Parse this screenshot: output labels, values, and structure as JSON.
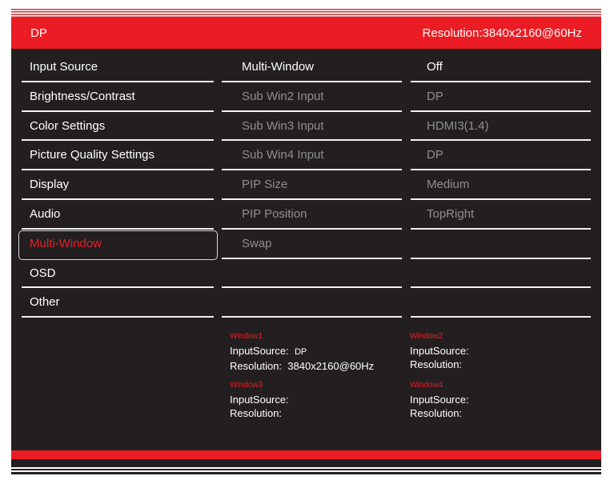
{
  "header": {
    "source": "DP",
    "resolution": "Resolution:3840x2160@60Hz"
  },
  "menu": {
    "items": [
      {
        "label": "Input Source"
      },
      {
        "label": "Brightness/Contrast"
      },
      {
        "label": "Color Settings"
      },
      {
        "label": "Picture Quality Settings"
      },
      {
        "label": "Display"
      },
      {
        "label": "Audio"
      },
      {
        "label": "Multi-Window"
      },
      {
        "label": "OSD"
      },
      {
        "label": "Other"
      }
    ],
    "selected": "Multi-Window"
  },
  "settings": [
    {
      "label": "Multi-Window",
      "value": "Off",
      "enabled": true
    },
    {
      "label": "Sub Win2 Input",
      "value": "DP",
      "enabled": false
    },
    {
      "label": "Sub Win3 Input",
      "value": "HDMI3(1.4)",
      "enabled": false
    },
    {
      "label": "Sub Win4 Input",
      "value": "DP",
      "enabled": false
    },
    {
      "label": "PIP Size",
      "value": "Medium",
      "enabled": false
    },
    {
      "label": "PIP Position",
      "value": "TopRight",
      "enabled": false
    },
    {
      "label": "Swap",
      "value": "",
      "enabled": false
    }
  ],
  "windows": [
    {
      "title": "Window1",
      "input_label": "InputSource:",
      "input": "DP",
      "res_label": "Resolution:",
      "res": "3840x2160@60Hz"
    },
    {
      "title": "Window2",
      "input_label": "InputSource:",
      "input": "",
      "res_label": "Resolution:",
      "res": ""
    },
    {
      "title": "Window3",
      "input_label": "InputSource:",
      "input": "",
      "res_label": "Resolution:",
      "res": ""
    },
    {
      "title": "Window4",
      "input_label": "InputSource:",
      "input": "",
      "res_label": "Resolution:",
      "res": ""
    }
  ],
  "colors": {
    "accent": "#ec1c24",
    "background": "#231f20",
    "disabled": "#8f8f8f"
  }
}
